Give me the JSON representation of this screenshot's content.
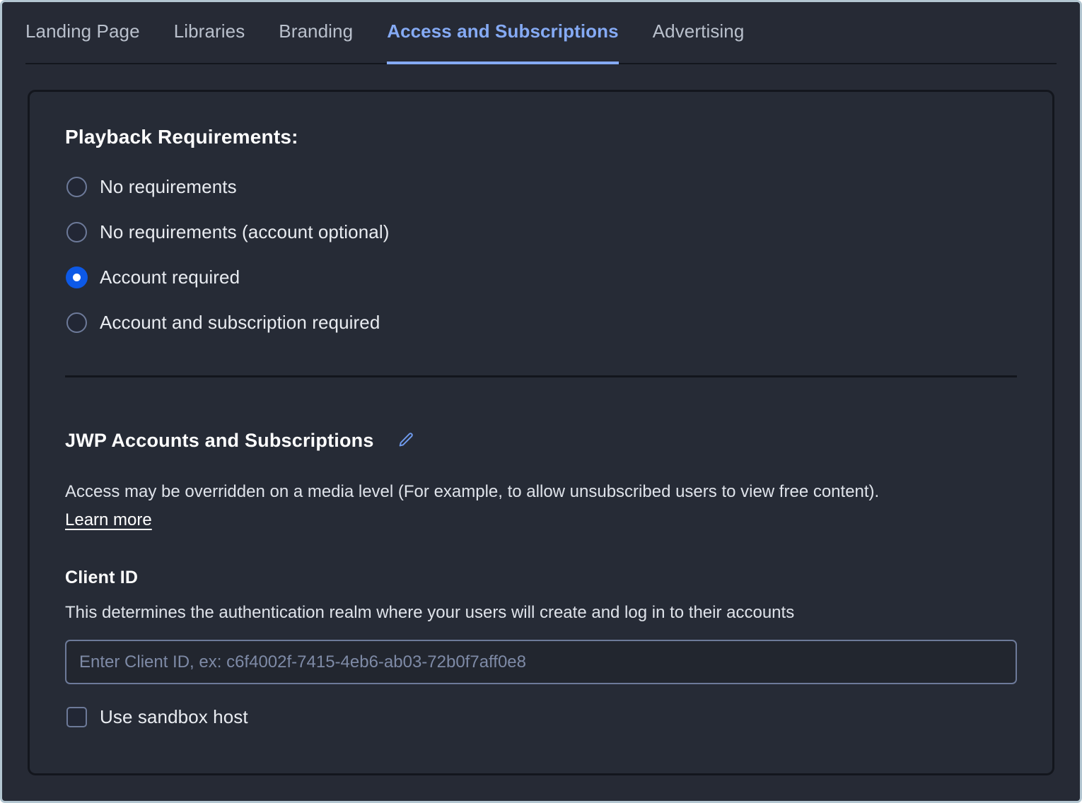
{
  "tabs": [
    {
      "label": "Landing Page",
      "active": false
    },
    {
      "label": "Libraries",
      "active": false
    },
    {
      "label": "Branding",
      "active": false
    },
    {
      "label": "Access and Subscriptions",
      "active": true
    },
    {
      "label": "Advertising",
      "active": false
    }
  ],
  "playback": {
    "title": "Playback Requirements:",
    "options": [
      {
        "label": "No requirements",
        "selected": false
      },
      {
        "label": "No requirements (account optional)",
        "selected": false
      },
      {
        "label": "Account required",
        "selected": true
      },
      {
        "label": "Account and subscription required",
        "selected": false
      }
    ]
  },
  "jwp": {
    "title": "JWP Accounts and Subscriptions",
    "edit_icon": "pencil-icon",
    "description": "Access may be overridden on a media level (For example, to allow unsubscribed users to view free content).",
    "learn_more_label": "Learn more"
  },
  "client_id": {
    "label": "Client ID",
    "help": "This determines the authentication realm where your users will create and log in to their accounts",
    "value": "",
    "placeholder": "Enter Client ID, ex: c6f4002f-7415-4eb6-ab03-72b0f7aff0e8"
  },
  "sandbox": {
    "label": "Use sandbox host",
    "checked": false
  },
  "colors": {
    "accent_blue": "#85aaf4",
    "radio_selected": "#0d59e6",
    "page_bg": "#262a35",
    "card_bg": "#262b36",
    "card_border": "#13161d",
    "control_border": "#6d7a99",
    "text_primary": "#ffffff",
    "text_secondary": "#dfe3ea",
    "tab_inactive": "#b9c0cc",
    "placeholder": "#7e8aa6",
    "frame_border": "#b3c6d1"
  }
}
